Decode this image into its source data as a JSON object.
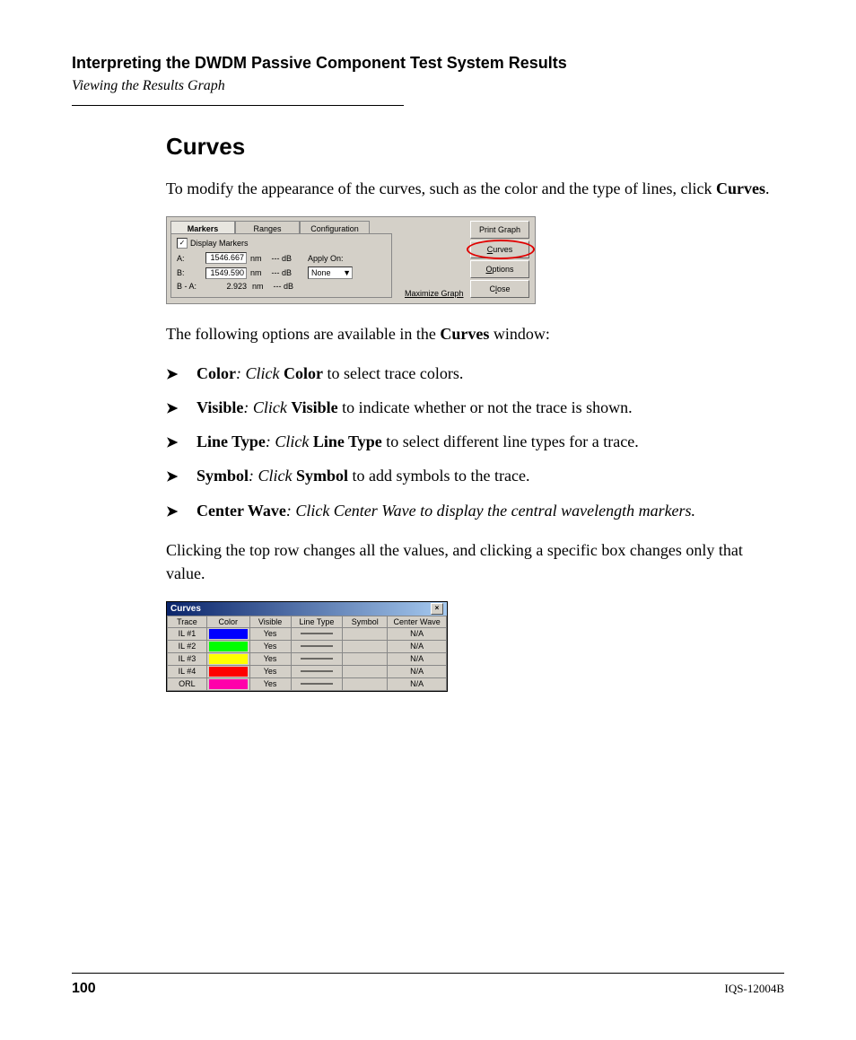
{
  "header": {
    "chapter": "Interpreting the DWDM Passive Component Test System Results",
    "subsection": "Viewing the Results Graph"
  },
  "heading": "Curves",
  "intro_pre": "To modify the appearance of the curves, such as the color and the type of lines, click ",
  "intro_bold": "Curves",
  "intro_post": ".",
  "options_lead_pre": "The following options are available in the ",
  "options_lead_bold": "Curves",
  "options_lead_post": " window:",
  "bullets": [
    {
      "term": "Color",
      "colon": ": Click ",
      "action": "Color",
      "rest": " to select trace colors."
    },
    {
      "term": "Visible",
      "colon": ": Click ",
      "action": "Visible",
      "rest": " to indicate whether or not the trace is shown."
    },
    {
      "term": "Line Type",
      "colon": ": Click ",
      "action": "Line Type",
      "rest": " to select different line types for a trace."
    },
    {
      "term": "Symbol",
      "colon": ": Click ",
      "action": "Symbol",
      "rest": " to add symbols to the trace."
    },
    {
      "term": "Center Wave",
      "colon": ": Click Center Wave to display the central wavelength markers.",
      "action": "",
      "rest": ""
    }
  ],
  "closing": "Clicking the top row changes all the values, and clicking a specific box changes only that value.",
  "ui1": {
    "tabs": {
      "markers": "Markers",
      "ranges": "Ranges",
      "configuration": "Configuration"
    },
    "display_markers": "Display Markers",
    "checked": "✓",
    "rows": {
      "a": {
        "label": "A:",
        "val": "1546.667",
        "unit": "nm",
        "db": "--- dB"
      },
      "b": {
        "label": "B:",
        "val": "1549.590",
        "unit": "nm",
        "db": "--- dB"
      },
      "ba": {
        "label": "B - A:",
        "val": "2.923",
        "unit": "nm",
        "db": "--- dB"
      }
    },
    "apply_on": "Apply On:",
    "apply_val": "None",
    "buttons": {
      "print": "Print Graph",
      "curves": "Curves",
      "options": "Options",
      "close": "Close"
    },
    "maximize": "Maximize Graph"
  },
  "ui2": {
    "title": "Curves",
    "headers": {
      "trace": "Trace",
      "color": "Color",
      "visible": "Visible",
      "linetype": "Line Type",
      "symbol": "Symbol",
      "centerwave": "Center Wave"
    },
    "rows": [
      {
        "trace": "IL #1",
        "color": "#0000ff",
        "visible": "Yes",
        "cw": "N/A"
      },
      {
        "trace": "IL #2",
        "color": "#00ff00",
        "visible": "Yes",
        "cw": "N/A"
      },
      {
        "trace": "IL #3",
        "color": "#ffff00",
        "visible": "Yes",
        "cw": "N/A"
      },
      {
        "trace": "IL #4",
        "color": "#ff0000",
        "visible": "Yes",
        "cw": "N/A"
      },
      {
        "trace": "ORL",
        "color": "#ff00aa",
        "visible": "Yes",
        "cw": "N/A"
      }
    ]
  },
  "footer": {
    "page": "100",
    "docid": "IQS-12004B"
  }
}
